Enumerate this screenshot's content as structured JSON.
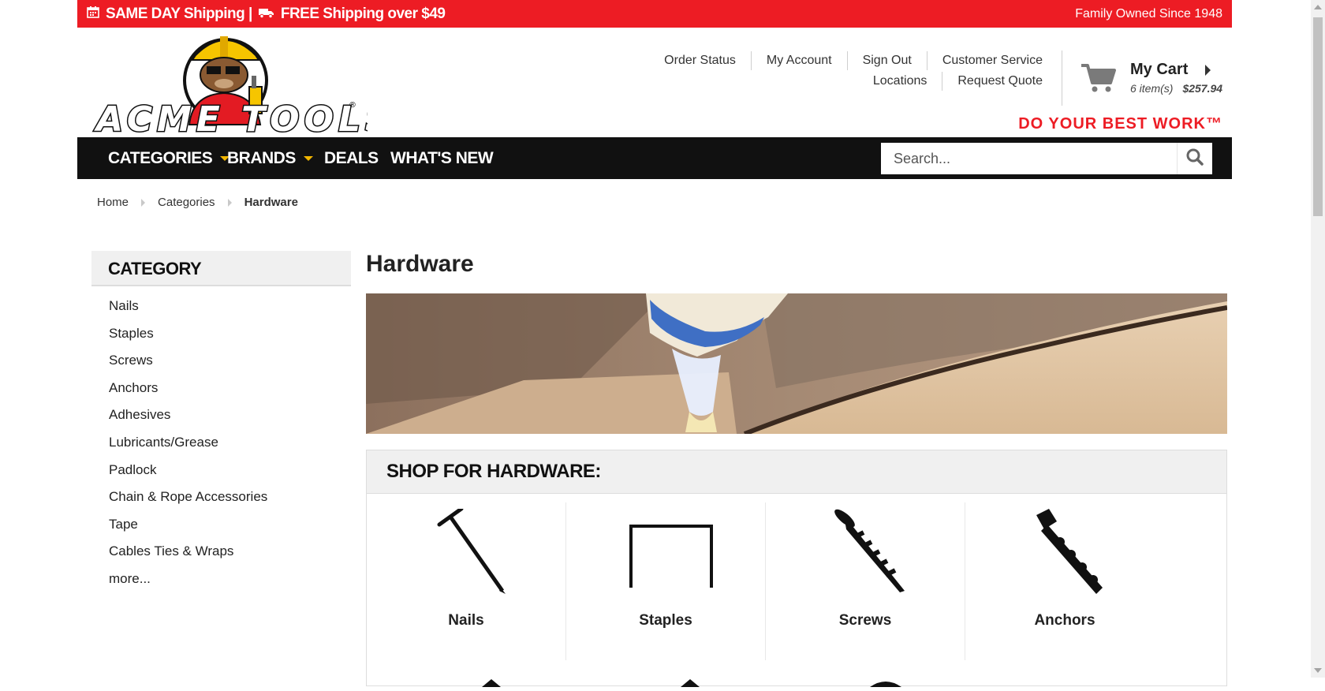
{
  "promo": {
    "left_text": "SAME DAY Shipping | ",
    "left_text2": "FREE Shipping over $49",
    "right_text": "Family Owned Since 1948"
  },
  "header": {
    "logo_text": "ACME TOOLS",
    "links_row1": [
      "Order Status",
      "My Account",
      "Sign Out",
      "Customer Service"
    ],
    "links_row2": [
      "Locations",
      "Request Quote"
    ],
    "cart_title": "My Cart",
    "cart_items": "6 item(s)",
    "cart_total": "$257.94",
    "tagline": "DO YOUR BEST WORK™"
  },
  "nav": {
    "items": [
      "CATEGORIES",
      "BRANDS",
      "DEALS",
      "WHAT'S NEW"
    ],
    "search_placeholder": "Search..."
  },
  "breadcrumb": [
    "Home",
    "Categories",
    "Hardware"
  ],
  "sidebar": {
    "title": "CATEGORY",
    "items": [
      "Nails",
      "Staples",
      "Screws",
      "Anchors",
      "Adhesives",
      "Lubricants/Grease",
      "Padlock",
      "Chain & Rope Accessories",
      "Tape",
      "Cables Ties & Wraps",
      "more..."
    ]
  },
  "main": {
    "title": "Hardware",
    "shop_title": "SHOP FOR HARDWARE:",
    "tiles": [
      {
        "label": "Nails",
        "icon": "nail-icon"
      },
      {
        "label": "Staples",
        "icon": "staple-icon"
      },
      {
        "label": "Screws",
        "icon": "screw-icon"
      },
      {
        "label": "Anchors",
        "icon": "anchor-bolt-icon"
      }
    ]
  },
  "colors": {
    "brand_red": "#ed1c24",
    "nav_bg": "#111111",
    "caret_yellow": "#f2b600"
  }
}
